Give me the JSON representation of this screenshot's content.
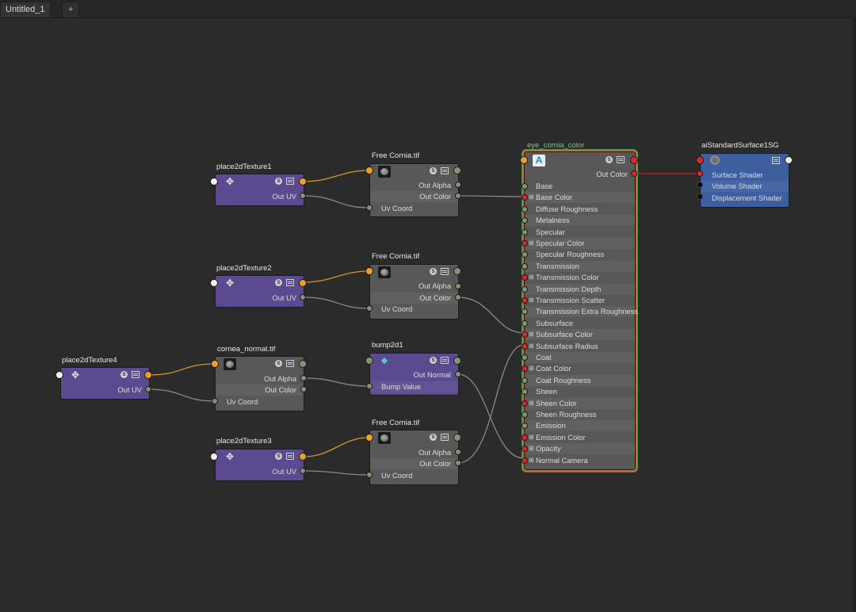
{
  "tabs": {
    "active": "Untitled_1",
    "add": "+"
  },
  "nodes": {
    "place1": {
      "title": "place2dTexture1",
      "out": "Out UV"
    },
    "place2": {
      "title": "place2dTexture2",
      "out": "Out UV"
    },
    "place3": {
      "title": "place2dTexture3",
      "out": "Out UV"
    },
    "place4": {
      "title": "place2dTexture4",
      "out": "Out UV"
    },
    "file1": {
      "title": "Free Cornia.tif",
      "out_alpha": "Out Alpha",
      "out_color": "Out Color",
      "uv": "Uv Coord"
    },
    "file2": {
      "title": "Free Cornia.tif",
      "out_alpha": "Out Alpha",
      "out_color": "Out Color",
      "uv": "Uv Coord"
    },
    "file3": {
      "title": "cornea_normal.tif",
      "out_alpha": "Out Alpha",
      "out_color": "Out Color",
      "uv": "Uv Coord"
    },
    "file4": {
      "title": "Free Cornia.tif",
      "out_alpha": "Out Alpha",
      "out_color": "Out Color",
      "uv": "Uv Coord"
    },
    "bump": {
      "title": "bump2d1",
      "out": "Out Normal",
      "in": "Bump Value"
    },
    "shader": {
      "title": "eye_cornia_color",
      "out": "Out Color",
      "attrs": [
        "Base",
        "Base Color",
        "Diffuse Roughness",
        "Metalness",
        "Specular",
        "Specular Color",
        "Specular Roughness",
        "Transmission",
        "Transmission Color",
        "Transmission Depth",
        "Transmission Scatter",
        "Transmission Extra Roughness",
        "Subsurface",
        "Subsurface Color",
        "Subsurface Radius",
        "Coat",
        "Coat Color",
        "Coat Roughness",
        "Sheen",
        "Sheen Color",
        "Sheen Roughness",
        "Emission",
        "Emission Color",
        "Opacity",
        "Normal Camera"
      ]
    },
    "sg": {
      "title": "aiStandardSurface1SG",
      "inputs": [
        "Surface Shader",
        "Volume Shader",
        "Displacement Shader"
      ]
    }
  },
  "badge_letter": "S",
  "colors": {
    "background": "#2b2b2b",
    "texture_node": "#5b4a8f",
    "file_node": "#585858",
    "sg_node": "#3d5f9f",
    "uv_wire": "#d8961e",
    "color_wire": "#8a8a8a",
    "shader_wire": "#d02020",
    "selection": "#d8622f"
  }
}
